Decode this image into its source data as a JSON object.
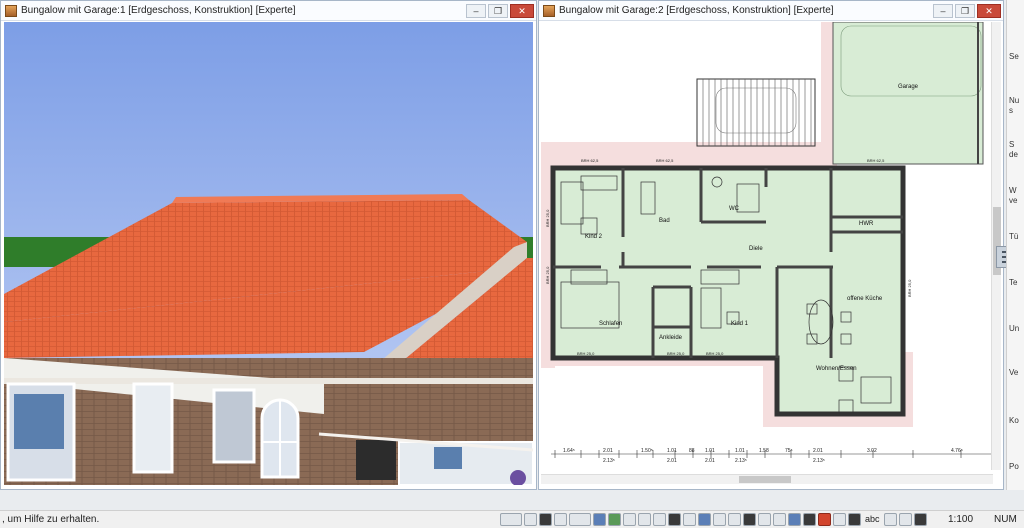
{
  "left_window": {
    "title": "Bungalow mit Garage:1 [Erdgeschoss, Konstruktion] [Experte]",
    "controls": [
      "‒",
      "❐",
      "✕"
    ]
  },
  "right_window": {
    "title": "Bungalow mit Garage:2 [Erdgeschoss, Konstruktion] [Experte]",
    "controls": [
      "‒",
      "❐",
      "✕"
    ]
  },
  "plan": {
    "rooms": {
      "garage": "Garage",
      "kind2": "Kind 2",
      "bad": "Bad",
      "wc": "WC",
      "hwr": "HWR",
      "diele": "Diele",
      "schlafen": "Schlafen",
      "ankleide": "Ankleide",
      "kind1": "Kind 1",
      "kueche": "offene Küche",
      "wohnen": "Wohnen/Essen"
    },
    "brh_labels": {
      "top1": "BRH 62,5",
      "top2": "BRH 62,5",
      "top3": "BRH 62,5",
      "bottom1": "BRH 25,0",
      "bottom2": "BRH 25,0",
      "bottom3": "BRH 25,0",
      "left1": "BRH 25,0",
      "left2": "BRH 25,0",
      "right1": "BRH 25,0"
    },
    "dimensions": [
      "1.64⁵",
      "2.01",
      "2.13⁵",
      "1.50⁵",
      "1.01",
      "2.01",
      "88",
      "1.01",
      "2.01",
      "1.01",
      "2.13⁵",
      "1.58",
      "75⁵",
      "2.01",
      "2.13⁵",
      "3.02",
      "4.76⁵"
    ]
  },
  "palette": {
    "items": [
      "Se",
      "Nu",
      "s",
      "S",
      "de",
      "W",
      "ve",
      "Tü",
      "Te",
      "Un",
      "Ve",
      "Ko",
      "Po"
    ]
  },
  "statusbar": {
    "help_text": ", um Hilfe zu erhalten.",
    "abc_label": "abc",
    "scale": "1:100",
    "num": "NUM"
  }
}
